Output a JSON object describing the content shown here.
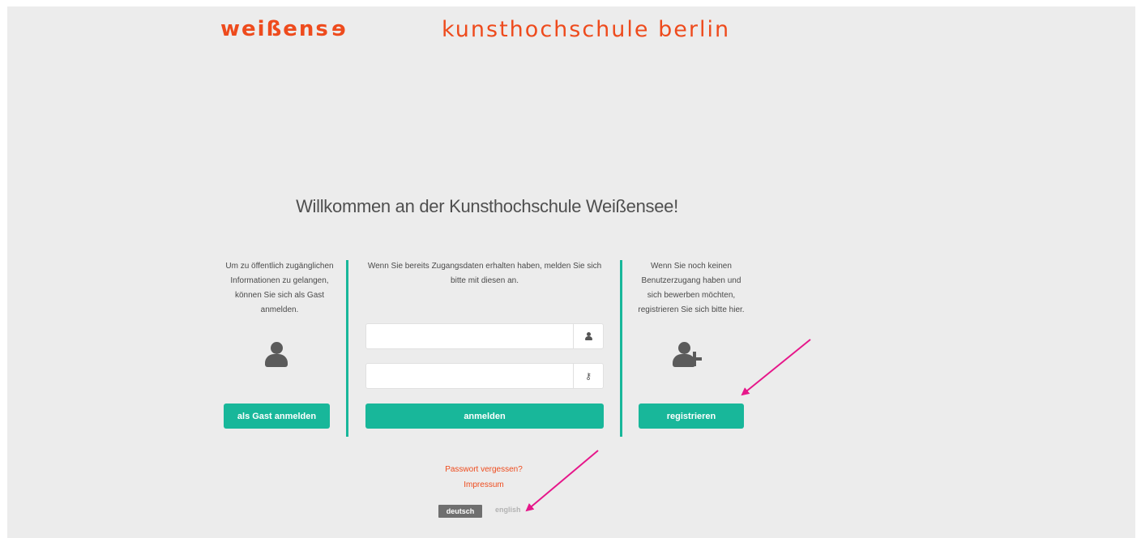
{
  "header": {
    "logo_left_main": "weißens",
    "logo_left_flipped": "e",
    "logo_right": "kunsthochschule berlin"
  },
  "welcome": "Willkommen an der Kunsthochschule Weißensee!",
  "guest": {
    "description": "Um zu öffentlich zugänglichen Informationen zu gelangen, können Sie sich als Gast anmelden.",
    "button_label": "als Gast anmelden",
    "icon": "user-icon"
  },
  "login": {
    "description": "Wenn Sie bereits Zugangsdaten erhalten haben, melden Sie sich bitte mit diesen an.",
    "username_value": "",
    "password_value": "",
    "username_icon": "user-icon",
    "password_icon": "key-icon",
    "button_label": "anmelden"
  },
  "register": {
    "description": "Wenn Sie noch keinen Benutzerzugang haben und sich bewerben möchten, registrieren Sie sich bitte hier.",
    "button_label": "registrieren",
    "icon": "user-plus-icon"
  },
  "links": {
    "forgot_password": "Passwort vergessen?",
    "impressum": "Impressum"
  },
  "language": {
    "active": "deutsch",
    "inactive": "english"
  },
  "colors": {
    "brand": "#ee4b1d",
    "accent": "#18b79a",
    "annotation": "#e6178a"
  }
}
